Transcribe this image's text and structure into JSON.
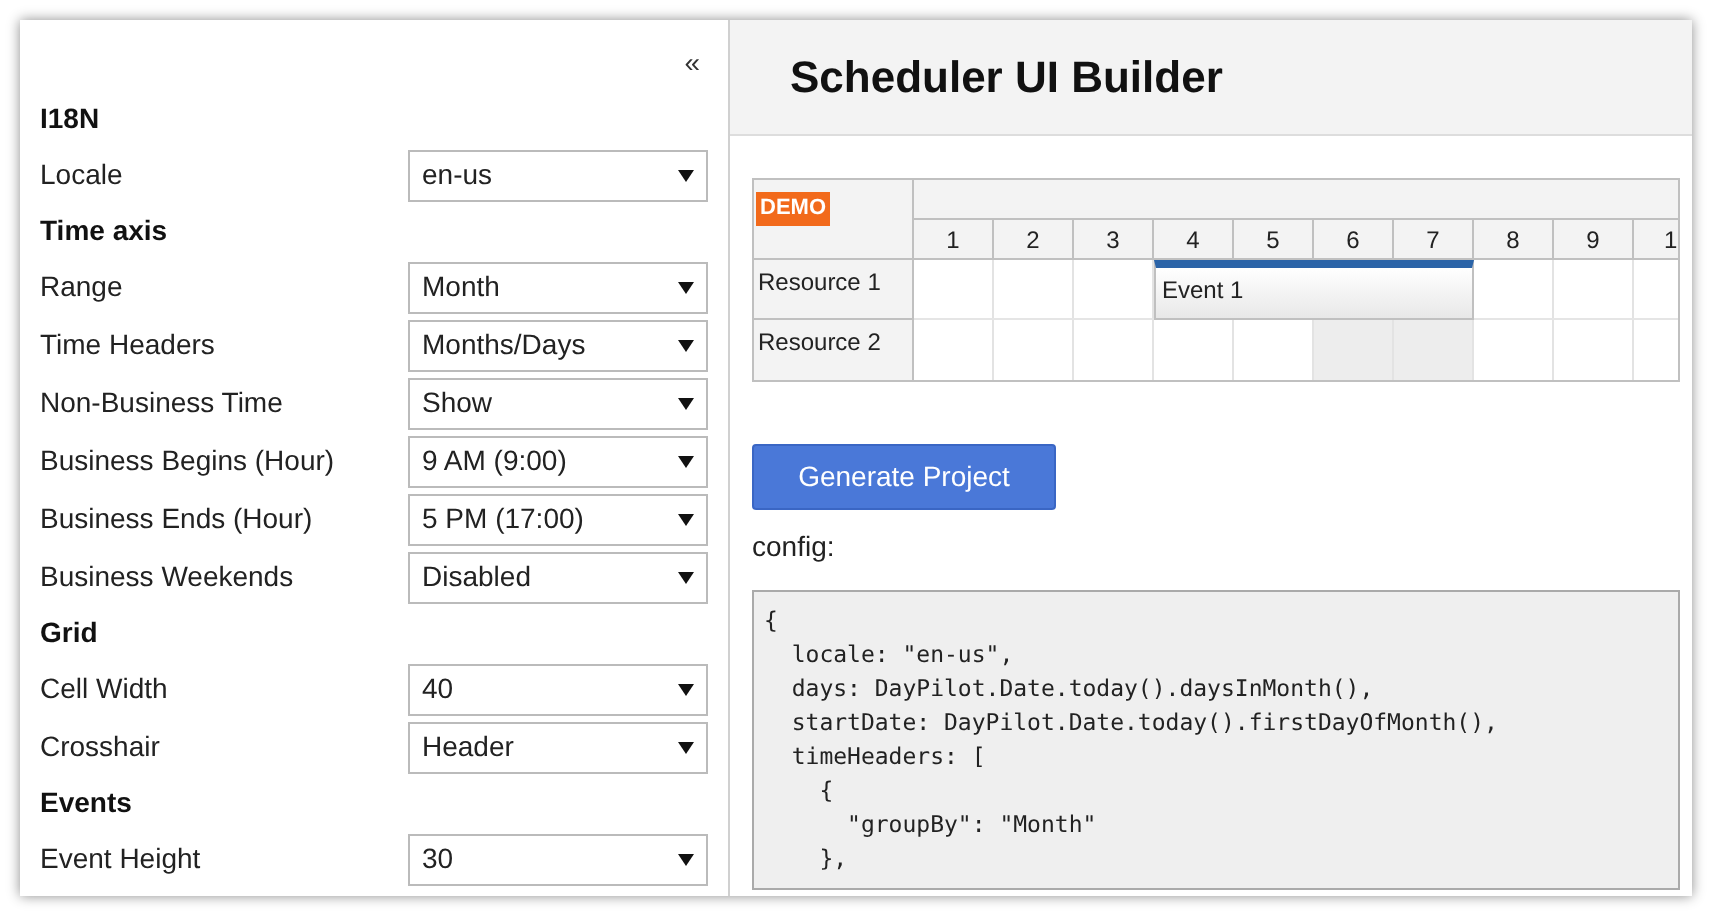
{
  "sidebar": {
    "collapse": "«",
    "items": [
      {
        "kind": "heading",
        "label": "I18N"
      },
      {
        "kind": "select",
        "label": "Locale",
        "value": "en-us"
      },
      {
        "kind": "heading",
        "label": "Time axis"
      },
      {
        "kind": "select",
        "label": "Range",
        "value": "Month"
      },
      {
        "kind": "select",
        "label": "Time Headers",
        "value": "Months/Days"
      },
      {
        "kind": "select",
        "label": "Non-Business Time",
        "value": "Show"
      },
      {
        "kind": "select",
        "label": "Business Begins (Hour)",
        "value": "9 AM (9:00)"
      },
      {
        "kind": "select",
        "label": "Business Ends (Hour)",
        "value": "5 PM (17:00)"
      },
      {
        "kind": "select",
        "label": "Business Weekends",
        "value": "Disabled"
      },
      {
        "kind": "heading",
        "label": "Grid"
      },
      {
        "kind": "select",
        "label": "Cell Width",
        "value": "40"
      },
      {
        "kind": "select",
        "label": "Crosshair",
        "value": "Header"
      },
      {
        "kind": "heading",
        "label": "Events"
      },
      {
        "kind": "select",
        "label": "Event Height",
        "value": "30"
      }
    ]
  },
  "main": {
    "title": "Scheduler UI Builder",
    "scheduler": {
      "badge": "DEMO",
      "columns": [
        {
          "label": "1",
          "weekend": false
        },
        {
          "label": "2",
          "weekend": false
        },
        {
          "label": "3",
          "weekend": false
        },
        {
          "label": "4",
          "weekend": false
        },
        {
          "label": "5",
          "weekend": false
        },
        {
          "label": "6",
          "weekend": true
        },
        {
          "label": "7",
          "weekend": true
        },
        {
          "label": "8",
          "weekend": false
        },
        {
          "label": "9",
          "weekend": false
        },
        {
          "label": "1",
          "weekend": false
        }
      ],
      "resources": [
        {
          "name": "Resource 1",
          "events": [
            {
              "text": "Event 1"
            }
          ]
        },
        {
          "name": "Resource 2"
        }
      ]
    },
    "button": "Generate Project",
    "config_label": "config:",
    "code": [
      "{",
      "  locale: \"en-us\",",
      "  days: DayPilot.Date.today().daysInMonth(),",
      "  startDate: DayPilot.Date.today().firstDayOfMonth(),",
      "  timeHeaders: [",
      "    {",
      "      \"groupBy\": \"Month\"",
      "    },"
    ]
  }
}
